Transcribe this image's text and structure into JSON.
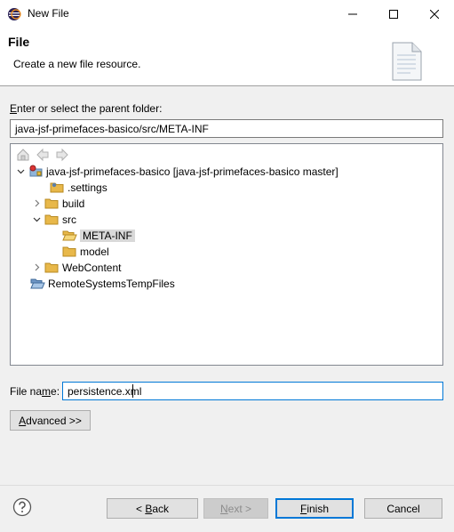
{
  "window": {
    "title": "New File"
  },
  "header": {
    "title": "File",
    "description": "Create a new file resource."
  },
  "parent": {
    "label_pre": "",
    "label_mnemonic": "E",
    "label_post": "nter or select the parent folder:",
    "value": "java-jsf-primefaces-basico/src/META-INF"
  },
  "tree": {
    "project": "java-jsf-primefaces-basico  [java-jsf-primefaces-basico master]",
    "settings": ".settings",
    "build": "build",
    "src": "src",
    "meta_inf": "META-INF",
    "model": "model",
    "webcontent": "WebContent",
    "remote": "RemoteSystemsTempFiles"
  },
  "filename": {
    "label_pre": "File na",
    "label_mnemonic": "m",
    "label_post": "e:",
    "value": "persistence.xml"
  },
  "buttons": {
    "advanced_mn": "A",
    "advanced_rest": "dvanced >>",
    "back_pre": "< ",
    "back_mn": "B",
    "back_rest": "ack",
    "next_mn": "N",
    "next_rest": "ext >",
    "finish_mn": "F",
    "finish_rest": "inish",
    "cancel": "Cancel"
  },
  "colors": {
    "accent": "#0078d7",
    "folder": "#e8b84a",
    "selection": "#d9d9d9"
  }
}
